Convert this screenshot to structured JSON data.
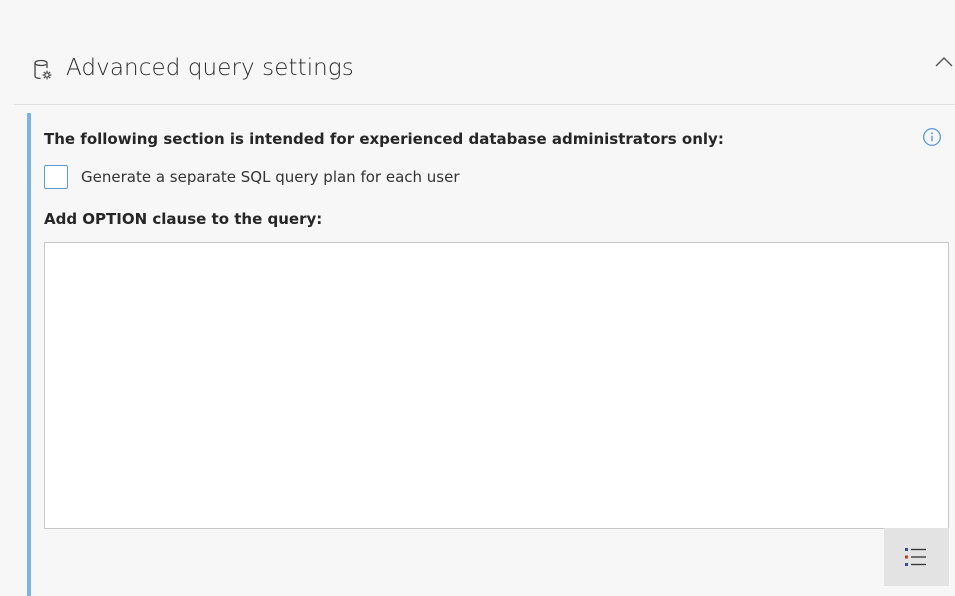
{
  "section": {
    "title": "Advanced query settings",
    "icon": "database-settings-icon",
    "collapse_icon": "chevron-up-icon"
  },
  "panel": {
    "accent_color": "#7cb4e8",
    "warning_text": "The following section is intended for experienced database administrators only:",
    "info_icon": "info-icon",
    "checkbox": {
      "label": "Generate a separate SQL query plan for each user",
      "checked": false
    },
    "option_clause": {
      "label": "Add OPTION clause to the query:",
      "value": ""
    },
    "list_button_icon": "bulleted-list-icon"
  }
}
